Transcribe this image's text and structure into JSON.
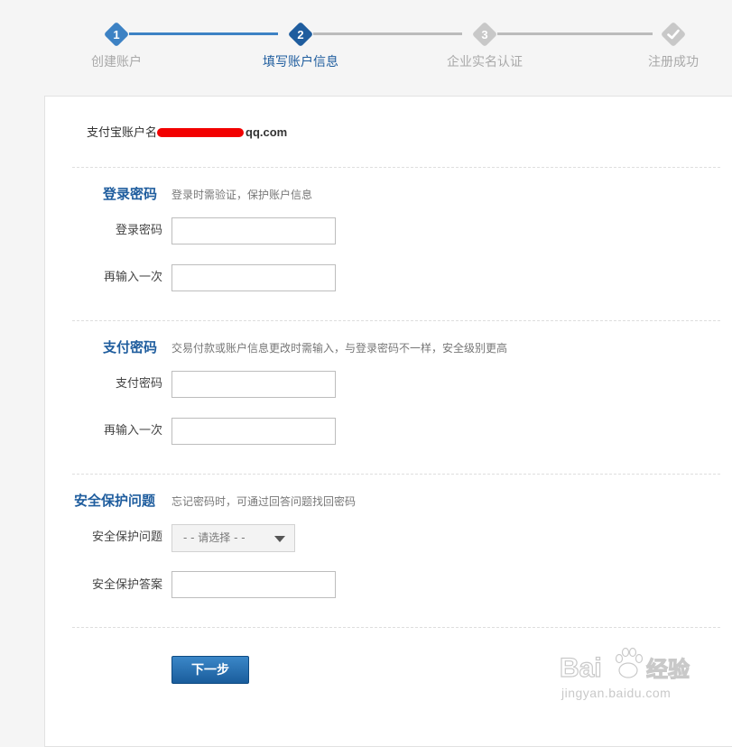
{
  "stepper": {
    "steps": [
      {
        "number": "1",
        "label": "创建账户",
        "state": "done"
      },
      {
        "number": "2",
        "label": "填写账户信息",
        "state": "current"
      },
      {
        "number": "3",
        "label": "企业实名认证",
        "state": "pending"
      },
      {
        "number": "",
        "label": "注册成功",
        "state": "pending",
        "icon": "check-icon"
      }
    ],
    "colors": {
      "done": "#3d82c4",
      "current": "#1f5d9e",
      "pending": "#c8c8c8"
    }
  },
  "account": {
    "label": "支付宝账户名",
    "masked_value_suffix": "qq.com",
    "mask_color": "#f20000"
  },
  "login_password": {
    "title": "登录密码",
    "description": "登录时需验证，保护账户信息",
    "fields": [
      {
        "label": "登录密码",
        "value": "",
        "placeholder": ""
      },
      {
        "label": "再输入一次",
        "value": "",
        "placeholder": ""
      }
    ]
  },
  "pay_password": {
    "title": "支付密码",
    "description": "交易付款或账户信息更改时需输入，与登录密码不一样，安全级别更高",
    "fields": [
      {
        "label": "支付密码",
        "value": "",
        "placeholder": ""
      },
      {
        "label": "再输入一次",
        "value": "",
        "placeholder": ""
      }
    ]
  },
  "security": {
    "title": "安全保护问题",
    "description": "忘记密码时，可通过回答问题找回密码",
    "question_label": "安全保护问题",
    "question_selected": "- - 请选择 - -",
    "answer_label": "安全保护答案",
    "answer_value": ""
  },
  "actions": {
    "next_label": "下一步"
  },
  "watermark": {
    "logo_text_left": "Bai",
    "logo_text_right": "经验",
    "url": "jingyan.baidu.com"
  },
  "theme": {
    "accent": "#1f5d9e",
    "button_bg": "#1a5d9c",
    "border": "#bdbdbd"
  }
}
